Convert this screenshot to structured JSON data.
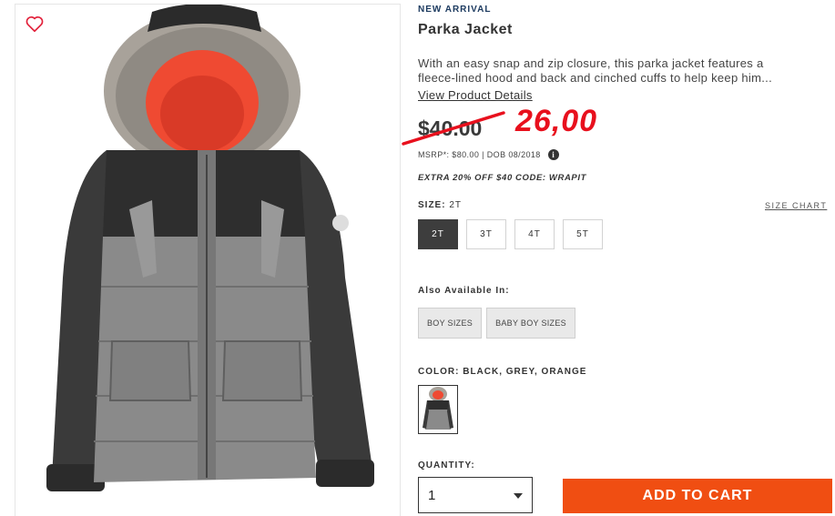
{
  "product": {
    "badge": "NEW ARRIVAL",
    "title": "Parka Jacket",
    "description_line1": "With an easy snap and zip closure, this parka jacket features a",
    "description_line2": "fleece-lined hood and back and cinched cuffs to help keep him...",
    "details_link": "View Product Details"
  },
  "pricing": {
    "old_price": "$40.00",
    "new_price": "26,00",
    "msrp_text": "MSRP*: $80.00 | DOB 08/2018",
    "info_icon": "info-icon",
    "promo_text": "EXTRA 20% OFF $40 CODE: WRAPIT"
  },
  "size": {
    "label": "SIZE:",
    "selected": "2T",
    "chart_link": "SIZE CHART",
    "options": [
      "2T",
      "3T",
      "4T",
      "5T"
    ]
  },
  "also_available": {
    "label": "Also Available In:",
    "options": [
      "BOY SIZES",
      "BABY BOY SIZES"
    ]
  },
  "color": {
    "label": "COLOR: BLACK, GREY, ORANGE"
  },
  "quantity": {
    "label": "QUANTITY:",
    "value": "1"
  },
  "cart": {
    "button_label": "ADD TO CART"
  },
  "colors": {
    "accent_orange": "#f04e12",
    "sale_red": "#e8101d",
    "badge_navy": "#1d3b60",
    "wishlist_red": "#e2203a"
  }
}
